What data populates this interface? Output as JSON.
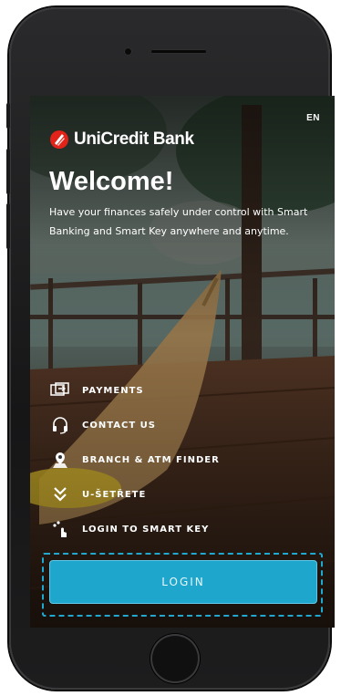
{
  "status": {
    "language": "EN"
  },
  "brand": {
    "name": "UniCredit Bank",
    "accent": "#e2231a"
  },
  "welcome": {
    "title": "Welcome!",
    "subtitle": "Have your finances safely under control with Smart Banking and Smart Key anywhere and anytime."
  },
  "menu": [
    {
      "label": "PAYMENTS",
      "icon": "payments-icon"
    },
    {
      "label": "CONTACT US",
      "icon": "headset-icon"
    },
    {
      "label": "BRANCH & ATM FINDER",
      "icon": "location-pin-icon"
    },
    {
      "label": "U-ŠETŘETE",
      "icon": "chevron-down-icon"
    },
    {
      "label": "LOGIN TO SMART KEY",
      "icon": "touch-key-icon"
    }
  ],
  "login": {
    "label": "LOGIN",
    "color": "#1fa6cc"
  }
}
